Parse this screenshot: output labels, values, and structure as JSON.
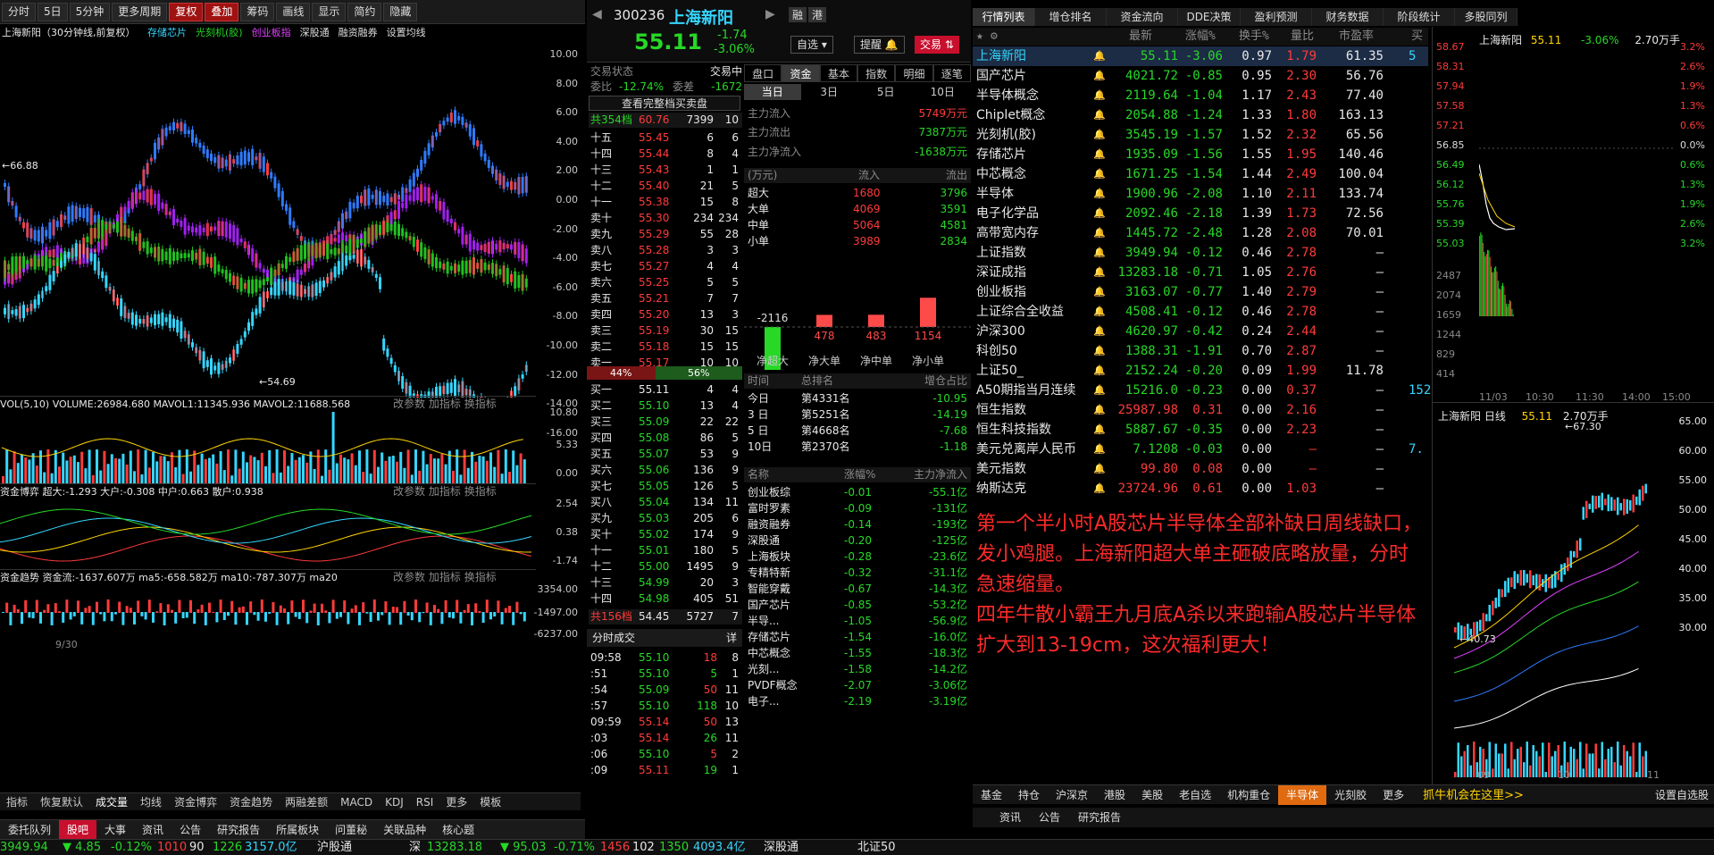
{
  "toolbar": {
    "items": [
      "分时",
      "5日",
      "5分钟",
      "更多周期",
      "复权",
      "叠加",
      "筹码",
      "画线",
      "显示",
      "简约",
      "隐藏"
    ]
  },
  "chart": {
    "title": "上海新阳（30分钟线,前复权）",
    "overlays": [
      "存储芯片",
      "光刻机(胶)",
      "创业板指",
      "深股通",
      "融资融券",
      "设置均线"
    ],
    "right_axis": [
      "10.00",
      "8.00",
      "6.00",
      "4.00",
      "2.00",
      "0.00",
      "-2.00",
      "-4.00",
      "-6.00",
      "-8.00",
      "-10.00",
      "-12.00",
      "-14.00",
      "-16.00"
    ],
    "high_label": "66.88",
    "low_label": "54.69",
    "vol_header": "VOL(5,10)  VOLUME:26984.680  MAVOL1:11345.936  MAVOL2:11688.568",
    "vol_axis": [
      "10.80",
      "5.33",
      "0.00"
    ],
    "zjbk_header": "资金博弈  超大:-1.293  大户:-0.308  中户:0.663  散户:0.938",
    "zjbk_axis": [
      "2.54",
      "0.38",
      "-1.74"
    ],
    "zjqs_header": "资金趋势  资金流:-1637.607万  ma5:-658.582万  ma10:-787.307万  ma20",
    "zjqs_axis": [
      "3354.00",
      "-1497.00",
      "-6237.00"
    ],
    "panel_actions": [
      "改参数",
      "加指标",
      "换指标"
    ],
    "date_label": "9/30",
    "indicator_tabs": [
      "指标",
      "恢复默认",
      "成交量",
      "均线",
      "资金博弈",
      "资金趋势",
      "两融差额",
      "MACD",
      "KDJ",
      "RSI",
      "更多",
      "模板"
    ]
  },
  "bottom_tabs": [
    "委托队列",
    "股吧",
    "大事",
    "资讯",
    "公告",
    "研究报告",
    "所属板块",
    "问董秘",
    "关联品种",
    "核心题"
  ],
  "status_bar": {
    "sh": "3949.94",
    "sh_chg": "4.85",
    "sh_pct": "-0.12%",
    "sh_up": "1010",
    "sh_flat": "90",
    "sh_down": "1226",
    "sh_amt": "3157.0亿",
    "hgt": "沪股通",
    "sz_label": "深",
    "sz": "13283.18",
    "sz_chg": "95.03",
    "sz_pct": "-0.71%",
    "sz_up": "1456",
    "sz_flat": "102",
    "sz_down": "1350",
    "sz_amt": "4093.4亿",
    "sgt": "深股通",
    "bz": "北证50"
  },
  "quote": {
    "code": "300236",
    "name": "上海新阳",
    "price": "55.11",
    "chg": "-1.74",
    "pct": "-3.06%",
    "tags": [
      "融",
      "港"
    ],
    "buttons": [
      "自选",
      "提醒",
      "交易"
    ],
    "trade_state_label": "交易状态",
    "trade_state": "交易中",
    "wb_label": "委比",
    "wb": "-12.74%",
    "wc_label": "委差",
    "wc": "-1672",
    "full_book": "查看完整档买卖盘",
    "ask_total": {
      "label": "共354档",
      "price": "60.76",
      "vol": "7399",
      "n": "10"
    },
    "asks": [
      {
        "l": "十五",
        "p": "55.45",
        "v": "6",
        "n": "6"
      },
      {
        "l": "十四",
        "p": "55.44",
        "v": "8",
        "n": "4"
      },
      {
        "l": "十三",
        "p": "55.43",
        "v": "1",
        "n": "1"
      },
      {
        "l": "十二",
        "p": "55.40",
        "v": "21",
        "n": "5"
      },
      {
        "l": "十一",
        "p": "55.38",
        "v": "15",
        "n": "8"
      },
      {
        "l": "卖十",
        "p": "55.30",
        "v": "234",
        "n": "234"
      },
      {
        "l": "卖九",
        "p": "55.29",
        "v": "55",
        "n": "28"
      },
      {
        "l": "卖八",
        "p": "55.28",
        "v": "3",
        "n": "3"
      },
      {
        "l": "卖七",
        "p": "55.27",
        "v": "4",
        "n": "4"
      },
      {
        "l": "卖六",
        "p": "55.25",
        "v": "5",
        "n": "5"
      },
      {
        "l": "卖五",
        "p": "55.21",
        "v": "7",
        "n": "7"
      },
      {
        "l": "卖四",
        "p": "55.20",
        "v": "13",
        "n": "3"
      },
      {
        "l": "卖三",
        "p": "55.19",
        "v": "30",
        "n": "15"
      },
      {
        "l": "卖二",
        "p": "55.18",
        "v": "15",
        "n": "15"
      },
      {
        "l": "卖一",
        "p": "55.17",
        "v": "10",
        "n": "10"
      }
    ],
    "ratio": {
      "sell": "44%",
      "buy": "56%"
    },
    "bids": [
      {
        "l": "买一",
        "p": "55.11",
        "v": "4",
        "n": "4"
      },
      {
        "l": "买二",
        "p": "55.10",
        "v": "13",
        "n": "4"
      },
      {
        "l": "买三",
        "p": "55.09",
        "v": "22",
        "n": "22"
      },
      {
        "l": "买四",
        "p": "55.08",
        "v": "86",
        "n": "5"
      },
      {
        "l": "买五",
        "p": "55.07",
        "v": "53",
        "n": "9"
      },
      {
        "l": "买六",
        "p": "55.06",
        "v": "136",
        "n": "9"
      },
      {
        "l": "买七",
        "p": "55.05",
        "v": "126",
        "n": "5"
      },
      {
        "l": "买八",
        "p": "55.04",
        "v": "134",
        "n": "11"
      },
      {
        "l": "买九",
        "p": "55.03",
        "v": "205",
        "n": "6"
      },
      {
        "l": "买十",
        "p": "55.02",
        "v": "174",
        "n": "9"
      },
      {
        "l": "十一",
        "p": "55.01",
        "v": "180",
        "n": "5"
      },
      {
        "l": "十二",
        "p": "55.00",
        "v": "1495",
        "n": "9"
      },
      {
        "l": "十三",
        "p": "54.99",
        "v": "20",
        "n": "3"
      },
      {
        "l": "十四",
        "p": "54.98",
        "v": "405",
        "n": "51"
      },
      {
        "l": "十五",
        "p": "54.96",
        "v": "112",
        "n": "22"
      }
    ],
    "bid_total": {
      "label": "共156档",
      "price": "54.45",
      "vol": "5727",
      "n": "7"
    },
    "trades_title": "分时成交",
    "trades_more": "详",
    "trades": [
      {
        "t": "09:58",
        "p": "55.10",
        "v": "18",
        "n": "8"
      },
      {
        "t": ":51",
        "p": "55.10",
        "v": "5",
        "n": "1"
      },
      {
        "t": ":54",
        "p": "55.09",
        "v": "50",
        "n": "11"
      },
      {
        "t": ":57",
        "p": "55.10",
        "v": "118",
        "n": "10"
      },
      {
        "t": "09:59",
        "p": "55.14",
        "v": "50",
        "n": "13"
      },
      {
        "t": ":03",
        "p": "55.14",
        "v": "26",
        "n": "11"
      },
      {
        "t": ":06",
        "p": "55.10",
        "v": "5",
        "n": "2"
      },
      {
        "t": ":09",
        "p": "55.11",
        "v": "19",
        "n": "1"
      }
    ]
  },
  "flow": {
    "tabs": [
      "盘口",
      "资金",
      "基本",
      "指数",
      "明细",
      "逐笔"
    ],
    "periods": [
      "当日",
      "3日",
      "5日",
      "10日"
    ],
    "main_in": {
      "label": "主力流入",
      "val": "5749万元"
    },
    "main_out": {
      "label": "主力流出",
      "val": "7387万元"
    },
    "main_net": {
      "label": "主力净流入",
      "val": "-1638万元"
    },
    "table_hdr": [
      "(万元)",
      "流入",
      "流出"
    ],
    "rows": [
      {
        "l": "超大",
        "in": "1680",
        "out": "3796"
      },
      {
        "l": "大单",
        "in": "4069",
        "out": "3591"
      },
      {
        "l": "中单",
        "in": "5064",
        "out": "4581"
      },
      {
        "l": "小单",
        "in": "3989",
        "out": "2834"
      }
    ],
    "bars": [
      {
        "l": "净超大",
        "v": -2116
      },
      {
        "l": "净大单",
        "v": 478
      },
      {
        "l": "净中单",
        "v": 483
      },
      {
        "l": "净小单",
        "v": 1154
      }
    ],
    "bar_labels": [
      "-2116",
      "478",
      "483",
      "1154"
    ],
    "rank_hdr": [
      "时间",
      "总排名",
      "增仓占比"
    ],
    "ranks": [
      {
        "t": "今日",
        "r": "第4331名",
        "v": "-10.95"
      },
      {
        "t": "3 日",
        "r": "第5251名",
        "v": "-14.19"
      },
      {
        "t": "5 日",
        "r": "第4668名",
        "v": "-7.68"
      },
      {
        "t": "10日",
        "r": "第2370名",
        "v": "-1.18"
      }
    ],
    "sect_hdr": [
      "名称",
      "涨幅%",
      "主力净流入"
    ],
    "sectors": [
      {
        "n": "创业板综",
        "p": "-0.01",
        "v": "-55.1亿"
      },
      {
        "n": "富时罗素",
        "p": "-0.09",
        "v": "-131亿"
      },
      {
        "n": "融资融券",
        "p": "-0.14",
        "v": "-193亿"
      },
      {
        "n": "深股通",
        "p": "-0.20",
        "v": "-125亿"
      },
      {
        "n": "上海板块",
        "p": "-0.28",
        "v": "-23.6亿"
      },
      {
        "n": "专精特新",
        "p": "-0.32",
        "v": "-31.1亿"
      },
      {
        "n": "智能穿戴",
        "p": "-0.67",
        "v": "-14.3亿"
      },
      {
        "n": "国产芯片",
        "p": "-0.85",
        "v": "-53.2亿"
      },
      {
        "n": "半导...",
        "p": "-1.05",
        "v": "-56.9亿"
      },
      {
        "n": "存储芯片",
        "p": "-1.54",
        "v": "-16.0亿"
      },
      {
        "n": "中芯概念",
        "p": "-1.55",
        "v": "-18.3亿"
      },
      {
        "n": "光刻...",
        "p": "-1.58",
        "v": "-14.2亿"
      },
      {
        "n": "PVDF概念",
        "p": "-2.07",
        "v": "-3.06亿"
      },
      {
        "n": "电子...",
        "p": "-2.19",
        "v": "-3.19亿"
      }
    ]
  },
  "right": {
    "tabs": [
      "行情列表",
      "增仓排名",
      "资金流向",
      "DDE决策",
      "盈利预测",
      "财务数据",
      "阶段统计",
      "多股同列"
    ],
    "cols": [
      "",
      "",
      "最新",
      "涨幅%",
      "换手%",
      "量比",
      "市盈率",
      "买"
    ],
    "rows": [
      {
        "n": "上海新阳",
        "p": "55.11",
        "c": "-3.06",
        "h": "0.97",
        "q": "1.79",
        "pe": "61.35",
        "b": "5"
      },
      {
        "n": "国产芯片",
        "p": "4021.72",
        "c": "-0.85",
        "h": "0.95",
        "q": "2.30",
        "pe": "56.76",
        "b": ""
      },
      {
        "n": "半导体概念",
        "p": "2119.64",
        "c": "-1.04",
        "h": "1.17",
        "q": "2.43",
        "pe": "77.40",
        "b": ""
      },
      {
        "n": "Chiplet概念",
        "p": "2054.88",
        "c": "-1.24",
        "h": "1.33",
        "q": "1.80",
        "pe": "163.13",
        "b": ""
      },
      {
        "n": "光刻机(胶)",
        "p": "3545.19",
        "c": "-1.57",
        "h": "1.52",
        "q": "2.32",
        "pe": "65.56",
        "b": ""
      },
      {
        "n": "存储芯片",
        "p": "1935.09",
        "c": "-1.56",
        "h": "1.55",
        "q": "1.95",
        "pe": "140.46",
        "b": ""
      },
      {
        "n": "中芯概念",
        "p": "1671.25",
        "c": "-1.54",
        "h": "1.44",
        "q": "2.49",
        "pe": "100.04",
        "b": ""
      },
      {
        "n": "半导体",
        "p": "1900.96",
        "c": "-2.08",
        "h": "1.10",
        "q": "2.11",
        "pe": "133.74",
        "b": ""
      },
      {
        "n": "电子化学品",
        "p": "2092.46",
        "c": "-2.18",
        "h": "1.39",
        "q": "1.73",
        "pe": "72.56",
        "b": ""
      },
      {
        "n": "高带宽内存",
        "p": "1445.72",
        "c": "-2.48",
        "h": "1.28",
        "q": "2.08",
        "pe": "70.01",
        "b": ""
      },
      {
        "n": "上证指数",
        "p": "3949.94",
        "c": "-0.12",
        "h": "0.46",
        "q": "2.78",
        "pe": "—",
        "b": ""
      },
      {
        "n": "深证成指",
        "p": "13283.18",
        "c": "-0.71",
        "h": "1.05",
        "q": "2.76",
        "pe": "—",
        "b": ""
      },
      {
        "n": "创业板指",
        "p": "3163.07",
        "c": "-0.77",
        "h": "1.40",
        "q": "2.79",
        "pe": "—",
        "b": ""
      },
      {
        "n": "上证综合全收益",
        "p": "4508.41",
        "c": "-0.12",
        "h": "0.46",
        "q": "2.78",
        "pe": "—",
        "b": ""
      },
      {
        "n": "沪深300",
        "p": "4620.97",
        "c": "-0.42",
        "h": "0.24",
        "q": "2.44",
        "pe": "—",
        "b": ""
      },
      {
        "n": "科创50",
        "p": "1388.31",
        "c": "-1.91",
        "h": "0.70",
        "q": "2.87",
        "pe": "—",
        "b": ""
      },
      {
        "n": "上证50_",
        "p": "2152.24",
        "c": "-0.20",
        "h": "0.09",
        "q": "1.99",
        "pe": "11.78",
        "b": ""
      },
      {
        "n": "A50期指当月连续",
        "p": "15216.0",
        "c": "-0.23",
        "h": "0.00",
        "q": "0.37",
        "pe": "—",
        "b": "152"
      },
      {
        "n": "恒生指数",
        "p": "25987.98",
        "c": "0.31",
        "h": "0.00",
        "q": "2.16",
        "pe": "—",
        "b": ""
      },
      {
        "n": "恒生科技指数",
        "p": "5887.67",
        "c": "-0.35",
        "h": "0.00",
        "q": "2.23",
        "pe": "—",
        "b": ""
      },
      {
        "n": "美元兑离岸人民币",
        "p": "7.1208",
        "c": "-0.03",
        "h": "0.00",
        "q": "—",
        "pe": "—",
        "b": "7."
      },
      {
        "n": "美元指数",
        "p": "99.80",
        "c": "0.08",
        "h": "0.00",
        "q": "—",
        "pe": "—",
        "b": ""
      },
      {
        "n": "纳斯达克",
        "p": "23724.96",
        "c": "0.61",
        "h": "0.00",
        "q": "1.03",
        "pe": "—",
        "b": ""
      }
    ],
    "note": "第一个半小时A股芯片半导体全部补缺日周线缺口，发小鸡腿。上海新阳超大单主砸破底略放量，分时急速缩量。\n四年牛散小霸王九月底A杀以来跑输A股芯片半导体扩大到13-19cm，这次福利更大！",
    "bottom_tabs": [
      "基金",
      "持仓",
      "沪深京",
      "港股",
      "美股",
      "老自选",
      "机构重仓",
      "半导体",
      "光刻胶",
      "更多"
    ],
    "bottom_link": "抓牛机会在这里>>",
    "bottom_setting": "设置自选股",
    "sub_tabs": [
      "资讯",
      "公告",
      "研究报告"
    ]
  },
  "mini_intraday": {
    "name": "上海新阳",
    "price": "55.11",
    "pct": "-3.06%",
    "vol": "2.70万手",
    "left_axis": [
      "58.67",
      "58.31",
      "57.94",
      "57.58",
      "57.21",
      "56.85",
      "56.49",
      "56.12",
      "55.76",
      "55.39",
      "55.03"
    ],
    "right_axis": [
      "3.2%",
      "2.6%",
      "1.9%",
      "1.3%",
      "0.6%",
      "0.0%",
      "0.6%",
      "1.3%",
      "1.9%",
      "2.6%",
      "3.2%"
    ],
    "vol_axis": [
      "2487",
      "2074",
      "1659",
      "1244",
      "829",
      "414"
    ],
    "x_axis": [
      "11/03",
      "10:30",
      "11:30",
      "14:00",
      "15:00"
    ]
  },
  "mini_daily": {
    "title": "上海新阳 日线",
    "price": "55.11",
    "vol": "2.70万手",
    "axis": [
      "65.00",
      "60.00",
      "55.00",
      "50.00",
      "45.00",
      "40.00",
      "35.00",
      "30.00"
    ],
    "high_label": "67.30",
    "low_label": "40.73",
    "x_axis": [
      "09",
      "10",
      "11"
    ]
  },
  "colors": {
    "up": "#ff3b3b",
    "down": "#27d827",
    "accent": "#35d6ff",
    "brand": "#c8102e"
  }
}
